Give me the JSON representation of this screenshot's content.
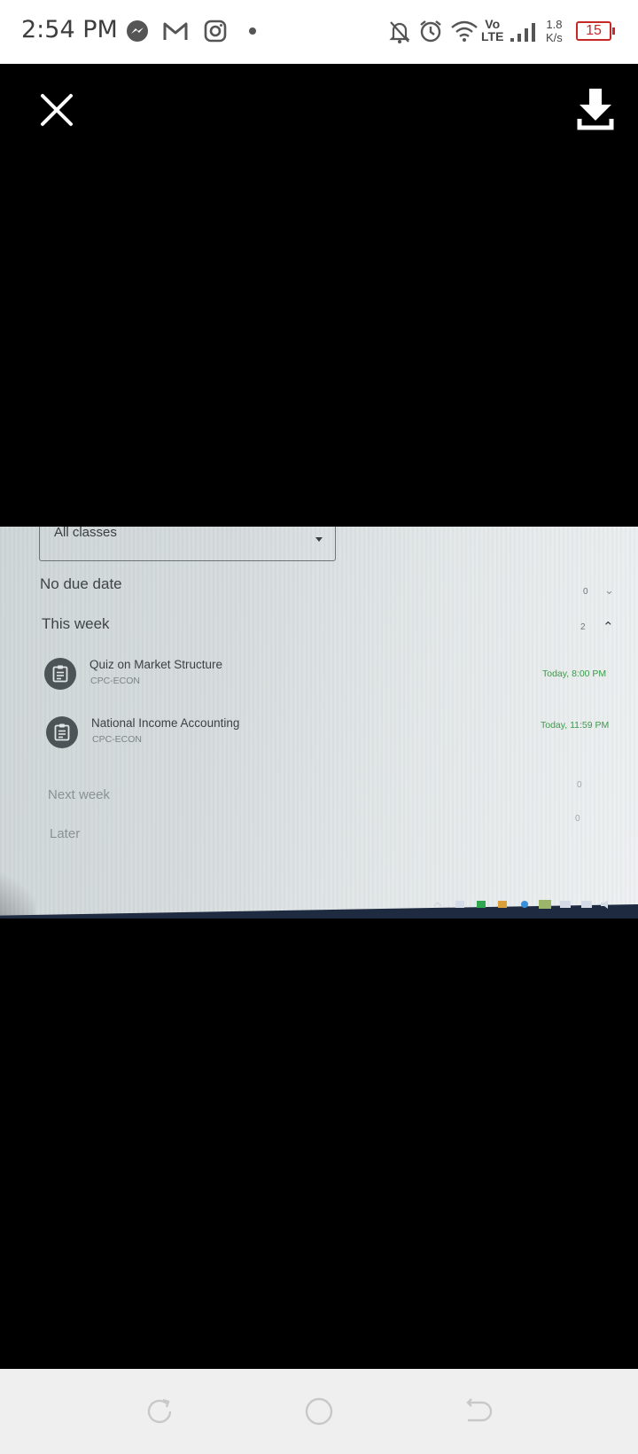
{
  "status_bar": {
    "time": "2:54 PM",
    "notification_icons": [
      "messenger-icon",
      "gmail-icon",
      "instagram-icon",
      "dot-icon"
    ],
    "status_icons": [
      "bell-off-icon",
      "alarm-icon",
      "wifi-icon",
      "volte-icon",
      "signal-icon"
    ],
    "volte_line1": "Vo",
    "volte_line2": "LTE",
    "speed_value": "1.8",
    "speed_unit": "K/s",
    "battery": "15",
    "battery_color": "#c62828"
  },
  "viewer": {
    "close_icon": "close-icon",
    "download_icon": "download-icon",
    "photo": {
      "filter_select": "All classes",
      "sections": {
        "no_due_date": {
          "label": "No due date",
          "count": "0"
        },
        "this_week": {
          "label": "This week",
          "count": "2"
        },
        "next_week": {
          "label": "Next week",
          "count": "0"
        },
        "later": {
          "label": "Later",
          "count": "0"
        }
      },
      "tasks": [
        {
          "title": "Quiz on Market Structure",
          "class": "CPC-ECON",
          "due": "Today, 8:00 PM"
        },
        {
          "title": "National Income Accounting",
          "class": "CPC-ECON",
          "due": "Today, 11:59 PM"
        }
      ],
      "due_color": "#3c9a4a"
    }
  },
  "nav_bar": {
    "buttons": [
      "recents-icon",
      "home-icon",
      "back-icon"
    ]
  }
}
